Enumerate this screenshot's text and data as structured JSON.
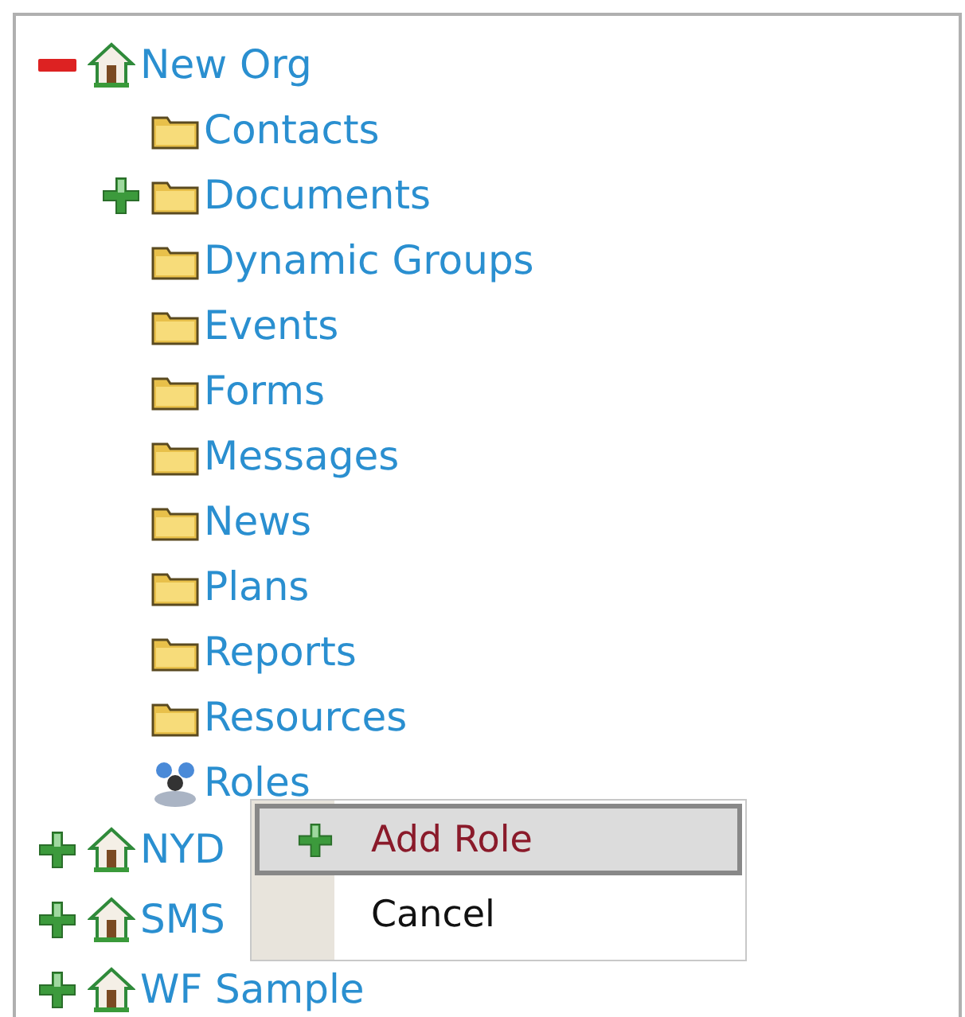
{
  "tree": [
    {
      "label": "New Org",
      "kind": "org",
      "expanded": true,
      "children": [
        {
          "label": "Contacts",
          "kind": "folder"
        },
        {
          "label": "Documents",
          "kind": "folder",
          "expanded": false
        },
        {
          "label": "Dynamic Groups",
          "kind": "folder"
        },
        {
          "label": "Events",
          "kind": "folder"
        },
        {
          "label": "Forms",
          "kind": "folder"
        },
        {
          "label": "Messages",
          "kind": "folder"
        },
        {
          "label": "News",
          "kind": "folder"
        },
        {
          "label": "Plans",
          "kind": "folder"
        },
        {
          "label": "Reports",
          "kind": "folder"
        },
        {
          "label": "Resources",
          "kind": "folder"
        },
        {
          "label": "Roles",
          "kind": "roles"
        }
      ]
    },
    {
      "label": "NYD",
      "kind": "org",
      "expanded": false
    },
    {
      "label": "SMS",
      "kind": "org",
      "expanded": false
    },
    {
      "label": "WF Sample",
      "kind": "org",
      "expanded": false
    }
  ],
  "context_menu": {
    "items": [
      {
        "label": "Add Role",
        "kind": "add",
        "selected": true
      },
      {
        "label": "Cancel",
        "kind": "plain",
        "selected": false
      }
    ]
  }
}
